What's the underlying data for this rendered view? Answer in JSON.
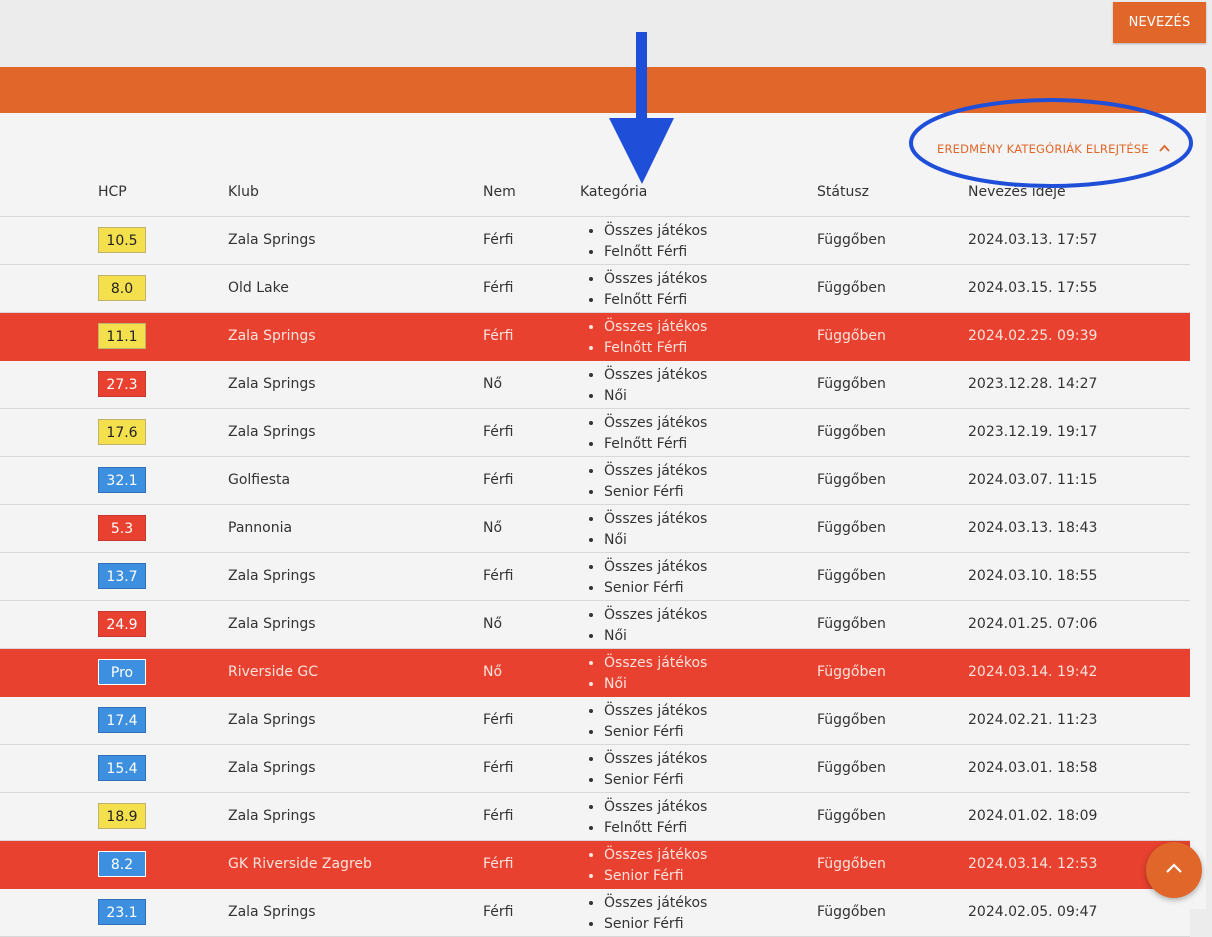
{
  "topbar": {
    "nevezes_button": "NEVEZÉS"
  },
  "toggle": {
    "label": "EREDMÉNY KATEGÓRIÁK ELREJTÉSE",
    "icon": "chevron-up-icon"
  },
  "columns": {
    "hcp": "HCP",
    "klub": "Klub",
    "nem": "Nem",
    "kategoria": "Kategória",
    "statusz": "Státusz",
    "nevezes_ideje": "Nevezés ideje"
  },
  "colors": {
    "accent": "#e0662a",
    "highlight_row": "#e8412f",
    "hcp_yellow": "#f4e04d",
    "hcp_red": "#e8412f",
    "hcp_blue": "#3d8fe0",
    "annotation": "#1f4fd8"
  },
  "rows": [
    {
      "hcp": "10.5",
      "hcp_color": "yellow",
      "club": "Zala Springs",
      "gender": "Férfi",
      "cat1": "Összes játékos",
      "cat2": "Felnőtt Férfi",
      "status": "Függőben",
      "date": "2024.03.13. 17:57",
      "highlight": false
    },
    {
      "hcp": "8.0",
      "hcp_color": "yellow",
      "club": "Old Lake",
      "gender": "Férfi",
      "cat1": "Összes játékos",
      "cat2": "Felnőtt Férfi",
      "status": "Függőben",
      "date": "2024.03.15. 17:55",
      "highlight": false
    },
    {
      "hcp": "11.1",
      "hcp_color": "yellow",
      "club": "Zala Springs",
      "gender": "Férfi",
      "cat1": "Összes játékos",
      "cat2": "Felnőtt Férfi",
      "status": "Függőben",
      "date": "2024.02.25. 09:39",
      "highlight": true
    },
    {
      "hcp": "27.3",
      "hcp_color": "red",
      "club": "Zala Springs",
      "gender": "Nő",
      "cat1": "Összes játékos",
      "cat2": "Női",
      "status": "Függőben",
      "date": "2023.12.28. 14:27",
      "highlight": false
    },
    {
      "hcp": "17.6",
      "hcp_color": "yellow",
      "club": "Zala Springs",
      "gender": "Férfi",
      "cat1": "Összes játékos",
      "cat2": "Felnőtt Férfi",
      "status": "Függőben",
      "date": "2023.12.19. 19:17",
      "highlight": false
    },
    {
      "hcp": "32.1",
      "hcp_color": "blue",
      "club": "Golfiesta",
      "gender": "Férfi",
      "cat1": "Összes játékos",
      "cat2": "Senior Férfi",
      "status": "Függőben",
      "date": "2024.03.07. 11:15",
      "highlight": false
    },
    {
      "hcp": "5.3",
      "hcp_color": "red",
      "club": "Pannonia",
      "gender": "Nő",
      "cat1": "Összes játékos",
      "cat2": "Női",
      "status": "Függőben",
      "date": "2024.03.13. 18:43",
      "highlight": false
    },
    {
      "hcp": "13.7",
      "hcp_color": "blue",
      "club": "Zala Springs",
      "gender": "Férfi",
      "cat1": "Összes játékos",
      "cat2": "Senior Férfi",
      "status": "Függőben",
      "date": "2024.03.10. 18:55",
      "highlight": false
    },
    {
      "hcp": "24.9",
      "hcp_color": "red",
      "club": "Zala Springs",
      "gender": "Nő",
      "cat1": "Összes játékos",
      "cat2": "Női",
      "status": "Függőben",
      "date": "2024.01.25. 07:06",
      "highlight": false
    },
    {
      "hcp": "Pro",
      "hcp_color": "blue",
      "club": "Riverside GC",
      "gender": "Nő",
      "cat1": "Összes játékos",
      "cat2": "Női",
      "status": "Függőben",
      "date": "2024.03.14. 19:42",
      "highlight": true
    },
    {
      "hcp": "17.4",
      "hcp_color": "blue",
      "club": "Zala Springs",
      "gender": "Férfi",
      "cat1": "Összes játékos",
      "cat2": "Senior Férfi",
      "status": "Függőben",
      "date": "2024.02.21. 11:23",
      "highlight": false
    },
    {
      "hcp": "15.4",
      "hcp_color": "blue",
      "club": "Zala Springs",
      "gender": "Férfi",
      "cat1": "Összes játékos",
      "cat2": "Senior Férfi",
      "status": "Függőben",
      "date": "2024.03.01. 18:58",
      "highlight": false
    },
    {
      "hcp": "18.9",
      "hcp_color": "yellow",
      "club": "Zala Springs",
      "gender": "Férfi",
      "cat1": "Összes játékos",
      "cat2": "Felnőtt Férfi",
      "status": "Függőben",
      "date": "2024.01.02. 18:09",
      "highlight": false
    },
    {
      "hcp": "8.2",
      "hcp_color": "blue",
      "club": "GK Riverside Zagreb",
      "gender": "Férfi",
      "cat1": "Összes játékos",
      "cat2": "Senior Férfi",
      "status": "Függőben",
      "date": "2024.03.14. 12:53",
      "highlight": true
    },
    {
      "hcp": "23.1",
      "hcp_color": "blue",
      "club": "Zala Springs",
      "gender": "Férfi",
      "cat1": "Összes játékos",
      "cat2": "Senior Férfi",
      "status": "Függőben",
      "date": "2024.02.05. 09:47",
      "highlight": false
    }
  ],
  "scroll_top": {
    "icon": "chevron-up-icon"
  }
}
